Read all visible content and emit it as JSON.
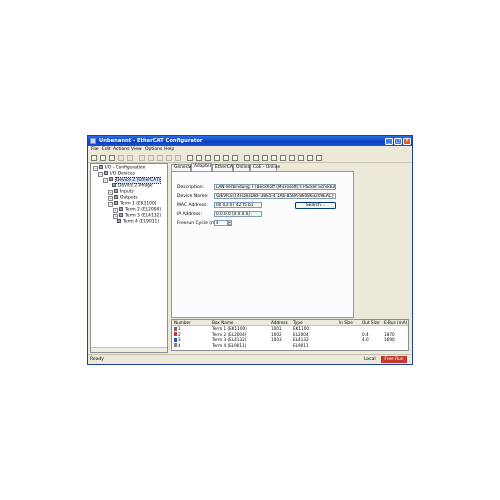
{
  "window": {
    "title": "Unbenannt - EtherCAT Configurator",
    "controls": [
      "_",
      "□",
      "×"
    ]
  },
  "menu": [
    "File",
    "Edit",
    "Actions",
    "View",
    "Options",
    "Help"
  ],
  "toolbar_icons": [
    "new-icon",
    "open-icon",
    "save-icon",
    "print-icon",
    "preview-icon",
    "cut-icon",
    "copy-icon",
    "paste-icon",
    "find-icon",
    "undo-icon",
    "delete-icon",
    "scan-icon",
    "tools-icon",
    "hand-icon",
    "check-icon",
    "cross-icon",
    "tag-icon",
    "key-icon",
    "search-icon",
    "refresh-icon",
    "io-icon",
    "config-icon",
    "run-icon",
    "settings-icon",
    "help-icon"
  ],
  "tree": [
    {
      "label": "I/O - Configuration",
      "level": 0,
      "expander": "−"
    },
    {
      "label": "I/O Devices",
      "level": 1,
      "expander": "−"
    },
    {
      "label": "Device 2 (EtherCAT)",
      "level": 2,
      "expander": "−",
      "selected": true
    },
    {
      "label": "Device 2-Image",
      "level": 3,
      "expander": ""
    },
    {
      "label": "Inputs",
      "level": 3,
      "expander": "+"
    },
    {
      "label": "Outputs",
      "level": 3,
      "expander": "+"
    },
    {
      "label": "Term 1 (EK1100)",
      "level": 3,
      "expander": "−"
    },
    {
      "label": "Term 2 (EL2004)",
      "level": 4,
      "expander": "+"
    },
    {
      "label": "Term 3 (EL4132)",
      "level": 4,
      "expander": "+"
    },
    {
      "label": "Term 4 (EL9011)",
      "level": 4,
      "expander": ""
    }
  ],
  "tabs": [
    "General",
    "Adapter",
    "EtherCAT",
    "Online",
    "CoE - Online"
  ],
  "active_tab": "Adapter",
  "adapter": {
    "description_label": "Description:",
    "description_value": "LAN-Verbindung 7 (Beckhoff (Microsoft)'s Packet Scheduler)",
    "device_name_label": "Device Name:",
    "device_name_value": "\\DEVICE\\{4FD83DBF-3BE5-4 1A6-85BA-8E0863209EAC}",
    "mac_label": "MAC Address:",
    "mac_value": "00 03 47 42 f5 b1",
    "search_button": "Search...",
    "ip_label": "IP Address:",
    "ip_value": "0.0.0.0 (0.0.0.0)",
    "freerun_label": "Freerun Cycle (ms):",
    "freerun_value": "4"
  },
  "list": {
    "columns": [
      "Number",
      "Box Name",
      "Address",
      "Type",
      "In Size",
      "Out Size",
      "E-Bus (mA)"
    ],
    "rows": [
      {
        "number": "1",
        "box_name": "Term 1 (EK1100)",
        "address": "1001",
        "type": "EK1100",
        "in_size": "",
        "out_size": "",
        "ebus": "",
        "color": "#6a6a6a"
      },
      {
        "number": "2",
        "box_name": "Term 2 (EL2004)",
        "address": "1002",
        "type": "EL2004",
        "in_size": "",
        "out_size": "0.4",
        "ebus": "1870",
        "color": "#d03030"
      },
      {
        "number": "3",
        "box_name": "Term 3 (EL4132)",
        "address": "1003",
        "type": "EL4132",
        "in_size": "",
        "out_size": "4.0",
        "ebus": "1690",
        "color": "#3050c8"
      },
      {
        "number": "4",
        "box_name": "Term 4 (EL9011)",
        "address": "",
        "type": "EL9011",
        "in_size": "",
        "out_size": "",
        "ebus": "",
        "color": "#808080"
      }
    ]
  },
  "status": {
    "ready": "Ready",
    "local": "Local",
    "mode": "Free Run",
    "mode_color": "#c0392b"
  }
}
